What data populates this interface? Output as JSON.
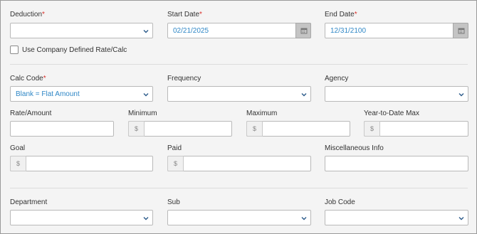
{
  "deduction": {
    "label": "Deduction",
    "value": ""
  },
  "start_date": {
    "label": "Start Date",
    "value": "02/21/2025"
  },
  "end_date": {
    "label": "End Date",
    "value": "12/31/2100"
  },
  "company_rate_checkbox": {
    "label": "Use Company Defined Rate/Calc",
    "checked": false
  },
  "calc_code": {
    "label": "Calc Code",
    "value": "Blank = Flat Amount"
  },
  "frequency": {
    "label": "Frequency",
    "value": ""
  },
  "agency": {
    "label": "Agency",
    "value": ""
  },
  "rate_amount": {
    "label": "Rate/Amount",
    "value": ""
  },
  "minimum": {
    "label": "Minimum",
    "prefix": "$",
    "value": ""
  },
  "maximum": {
    "label": "Maximum",
    "prefix": "$",
    "value": ""
  },
  "ytd_max": {
    "label": "Year-to-Date Max",
    "prefix": "$",
    "value": ""
  },
  "goal": {
    "label": "Goal",
    "prefix": "$",
    "value": ""
  },
  "paid": {
    "label": "Paid",
    "prefix": "$",
    "value": ""
  },
  "misc_info": {
    "label": "Miscellaneous Info",
    "value": ""
  },
  "department": {
    "label": "Department",
    "value": ""
  },
  "sub": {
    "label": "Sub",
    "value": ""
  },
  "job_code": {
    "label": "Job Code",
    "value": ""
  },
  "required_marker": "*",
  "colors": {
    "value_text": "#2f87c6",
    "required": "#d9322c",
    "calendar_button": "#c4c4c4"
  },
  "icons": {
    "select": "chevron-down-icon",
    "calendar": "calendar-icon"
  }
}
